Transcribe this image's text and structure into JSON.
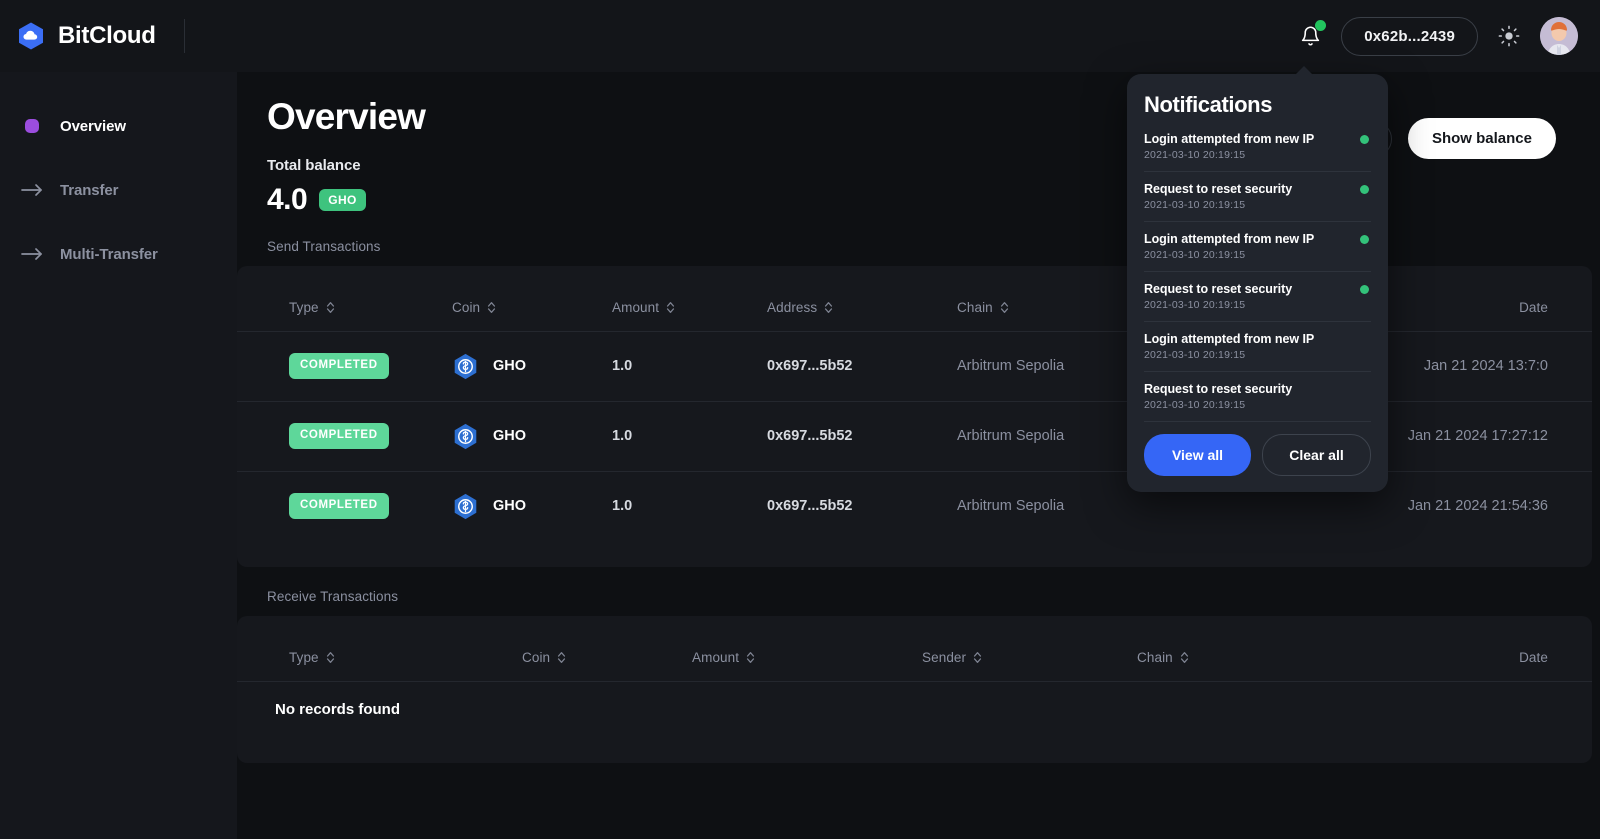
{
  "brand": {
    "name": "BitCloud",
    "logo_icon": "cloud-hexagon-icon",
    "logo_color": "#3b6ef5"
  },
  "topbar": {
    "bell_icon": "bell-icon",
    "bell_has_unread": true,
    "account_address": "0x62b...2439",
    "theme_icon": "sun-icon",
    "avatar_icon": "user-avatar"
  },
  "sidebar": {
    "items": [
      {
        "label": "Overview",
        "icon": "square-dot-icon",
        "active": true
      },
      {
        "label": "Transfer",
        "icon": "arrow-right-icon",
        "active": false
      },
      {
        "label": "Multi-Transfer",
        "icon": "arrow-right-icon",
        "active": false
      }
    ]
  },
  "main": {
    "page_title": "Overview",
    "search_icon": "search-icon",
    "show_balance_label": "Show balance",
    "balance_label": "Total balance",
    "balance_value": "4.0",
    "balance_coin": "GHO"
  },
  "send_section": {
    "title": "Send Transactions",
    "columns": [
      "Type",
      "Coin",
      "Amount",
      "Address",
      "Chain",
      "Date"
    ],
    "rows": [
      {
        "type": "COMPLETED",
        "coin": "GHO",
        "coin_icon": "gho-coin-icon",
        "amount": "1.0",
        "address": "0x697...5b52",
        "chain": "Arbitrum Sepolia",
        "date": "Jan 21 2024 13:7:0"
      },
      {
        "type": "COMPLETED",
        "coin": "GHO",
        "coin_icon": "gho-coin-icon",
        "amount": "1.0",
        "address": "0x697...5b52",
        "chain": "Arbitrum Sepolia",
        "date": "Jan 21 2024 17:27:12"
      },
      {
        "type": "COMPLETED",
        "coin": "GHO",
        "coin_icon": "gho-coin-icon",
        "amount": "1.0",
        "address": "0x697...5b52",
        "chain": "Arbitrum Sepolia",
        "date": "Jan 21 2024 21:54:36"
      }
    ]
  },
  "receive_section": {
    "title": "Receive Transactions",
    "columns": [
      "Type",
      "Coin",
      "Amount",
      "Sender",
      "Chain",
      "Date"
    ],
    "empty_message": "No records found"
  },
  "notifications": {
    "title": "Notifications",
    "items": [
      {
        "message": "Login attempted from new IP",
        "time": "2021-03-10 20:19:15",
        "unread": true
      },
      {
        "message": "Request to reset security",
        "time": "2021-03-10 20:19:15",
        "unread": true
      },
      {
        "message": "Login attempted from new IP",
        "time": "2021-03-10 20:19:15",
        "unread": true
      },
      {
        "message": "Request to reset security",
        "time": "2021-03-10 20:19:15",
        "unread": true
      },
      {
        "message": "Login attempted from new IP",
        "time": "2021-03-10 20:19:15",
        "unread": false
      },
      {
        "message": "Request to reset security",
        "time": "2021-03-10 20:19:15",
        "unread": false
      }
    ],
    "view_all_label": "View all",
    "clear_all_label": "Clear all"
  },
  "colors": {
    "accent_blue": "#3566f6",
    "success_green": "#3ec37e",
    "badge_green": "#5ed79a",
    "purple": "#9b4dde",
    "page_bg": "#0e1013",
    "panel_bg": "#21252d"
  }
}
